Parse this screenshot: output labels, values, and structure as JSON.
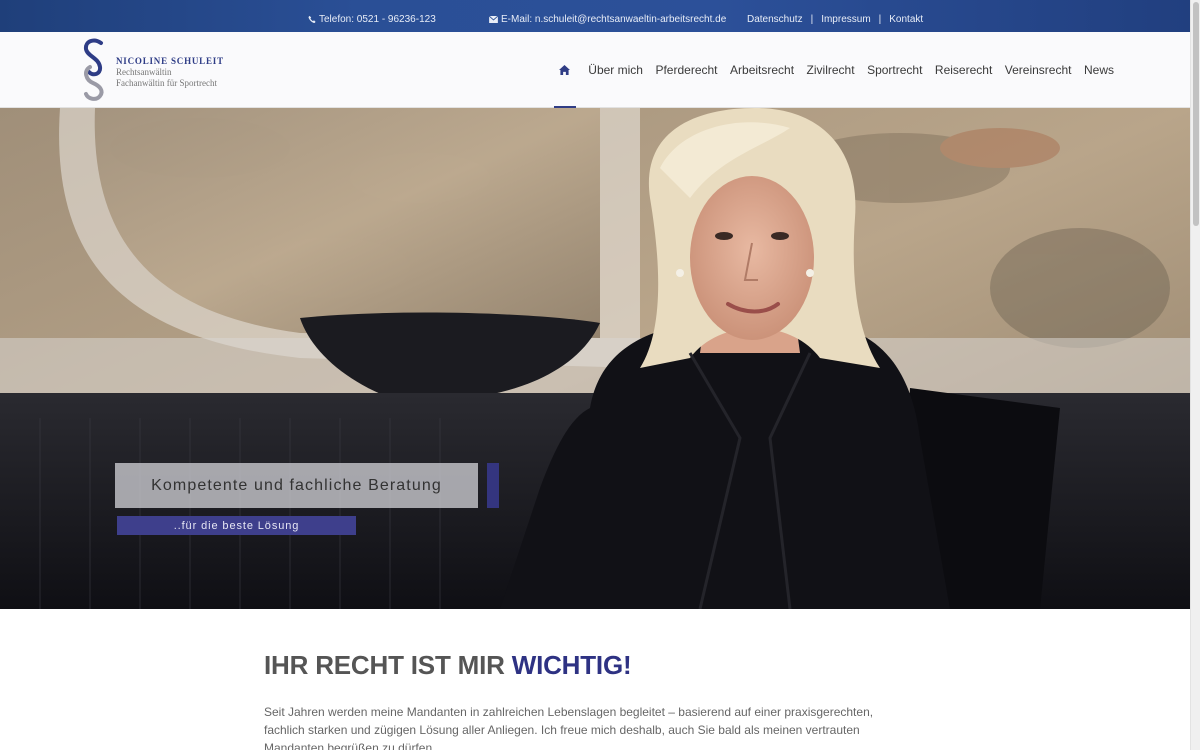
{
  "topbar": {
    "phone": "Telefon: 0521 - 96236-123",
    "email": "E-Mail: n.schuleit@rechtsanwaeltin-arbeitsrecht.de",
    "links": [
      "Datenschutz",
      "Impressum",
      "Kontakt"
    ],
    "separator": "|"
  },
  "logo": {
    "name": "NICOLINE SCHULEIT",
    "line1": "Rechtsanwältin",
    "line2": "Fachanwältin für Sportrecht"
  },
  "nav": {
    "active": "home",
    "items": [
      "Über mich",
      "Pferderecht",
      "Arbeitsrecht",
      "Zivilrecht",
      "Sportrecht",
      "Reiserecht",
      "Vereinsrecht",
      "News"
    ]
  },
  "hero": {
    "caption_title": "Kompetente und fachliche Beratung",
    "caption_sub": "..für die beste Lösung"
  },
  "content": {
    "headline_main": "IHR RECHT IST MIR ",
    "headline_accent": "WICHTIG!",
    "intro": "Seit Jahren werden meine Mandanten in zahlreichen Lebenslagen begleitet – basierend auf einer praxisgerechten, fachlich starken und zügigen Lösung aller Anliegen. Ich freue mich deshalb, auch Sie bald als meinen vertrauten Mandanten begrüßen zu dürfen."
  },
  "colors": {
    "brand": "#2e3283",
    "topbar": "#2a4f96",
    "caption_accent": "#3e3f8c"
  }
}
